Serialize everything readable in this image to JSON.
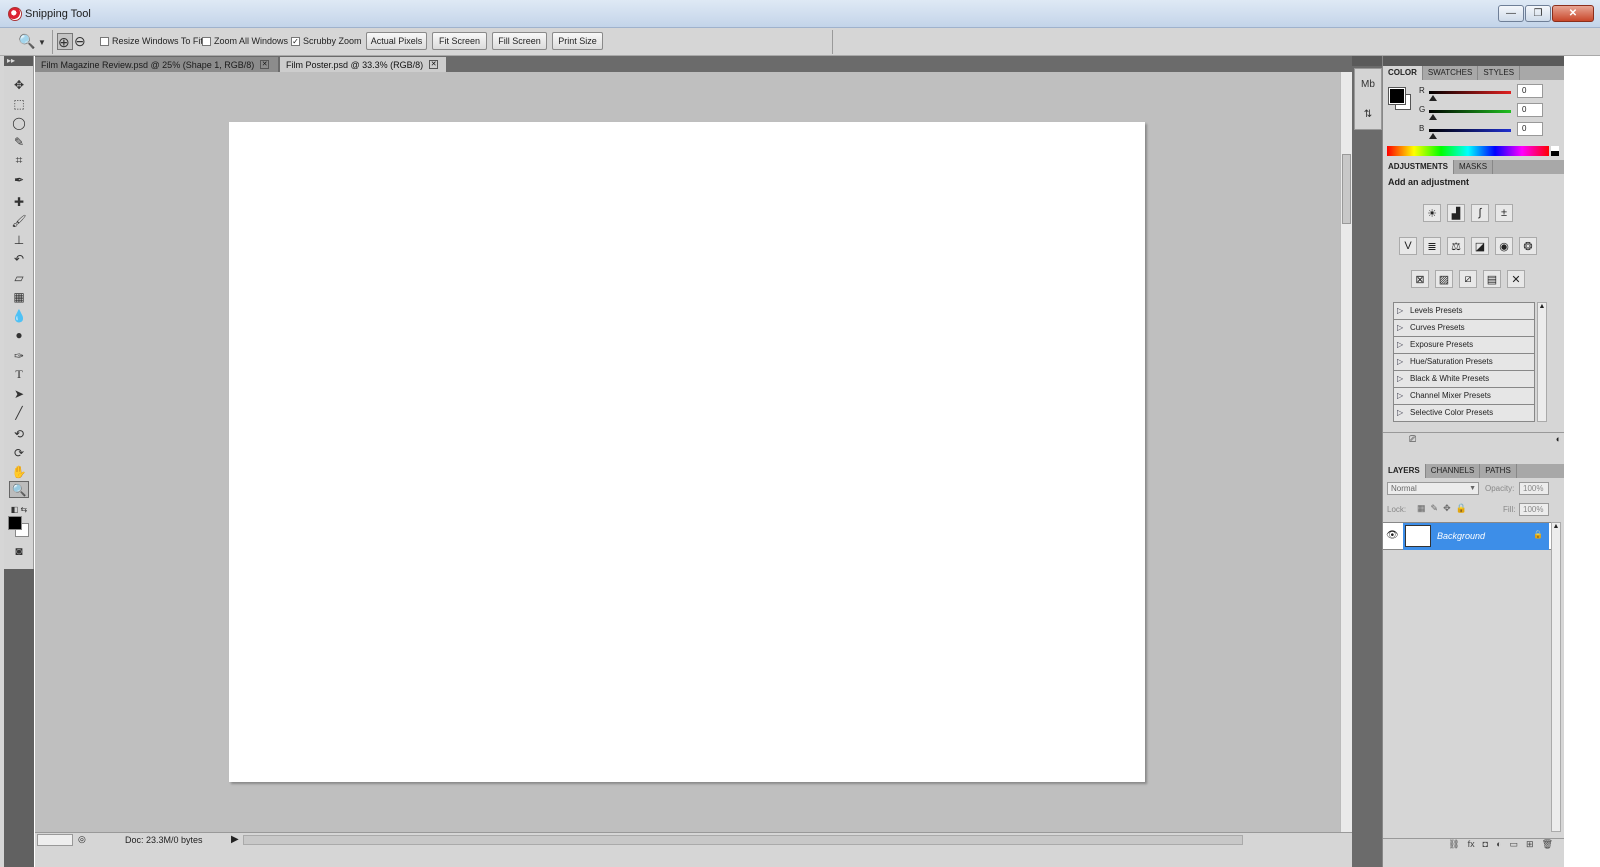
{
  "window": {
    "title": "Snipping Tool",
    "buttons": {
      "minimize": "—",
      "restore": "❐",
      "close": "✕"
    }
  },
  "options_bar": {
    "checkboxes": [
      {
        "label": "Resize Windows To Fit",
        "checked": false
      },
      {
        "label": "Zoom All Windows",
        "checked": false
      },
      {
        "label": "Scrubby Zoom",
        "checked": true
      }
    ],
    "buttons": [
      "Actual Pixels",
      "Fit Screen",
      "Fill Screen",
      "Print Size"
    ]
  },
  "doc_tabs": [
    {
      "label": "Film Magazine Review.psd @ 25% (Shape 1, RGB/8)",
      "active": false
    },
    {
      "label": "Film Poster.psd @ 33.3% (RGB/8)",
      "active": true
    }
  ],
  "status": {
    "doc": "Doc: 23.3M/0 bytes"
  },
  "color_panel": {
    "tabs": [
      "COLOR",
      "SWATCHES",
      "STYLES"
    ],
    "active_tab": "COLOR",
    "channels": [
      {
        "label": "R",
        "value": "0",
        "color": "#e02020"
      },
      {
        "label": "G",
        "value": "0",
        "color": "#20c020"
      },
      {
        "label": "B",
        "value": "0",
        "color": "#2030d0"
      }
    ],
    "foreground": "#000000",
    "background": "#ffffff"
  },
  "adjustments_panel": {
    "tabs": [
      "ADJUSTMENTS",
      "MASKS"
    ],
    "active_tab": "ADJUSTMENTS",
    "title": "Add an adjustment",
    "presets": [
      "Levels Presets",
      "Curves Presets",
      "Exposure Presets",
      "Hue/Saturation Presets",
      "Black & White Presets",
      "Channel Mixer Presets",
      "Selective Color Presets"
    ]
  },
  "layers_panel": {
    "tabs": [
      "LAYERS",
      "CHANNELS",
      "PATHS"
    ],
    "active_tab": "LAYERS",
    "blend_mode": "Normal",
    "opacity_label": "Opacity:",
    "opacity": "100%",
    "lock_label": "Lock:",
    "fill_label": "Fill:",
    "fill": "100%",
    "layers": [
      {
        "name": "Background",
        "selected": true,
        "locked": true
      }
    ]
  },
  "accent_color": "#3d8ee8"
}
